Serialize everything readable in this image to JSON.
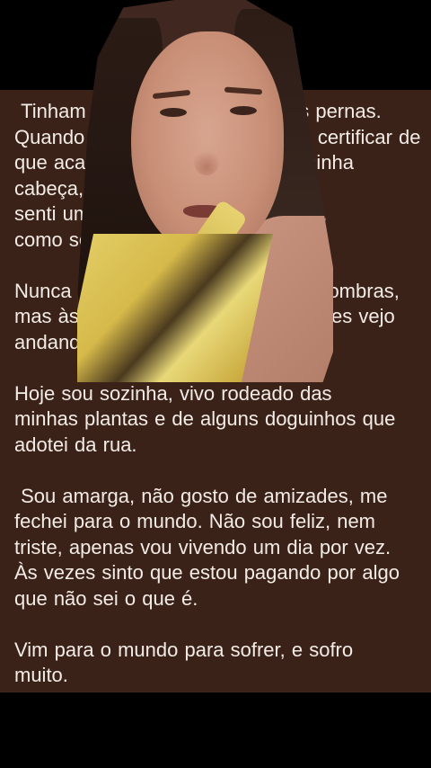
{
  "story": {
    "text": " Tinham brincado com as minhas pernas.\nQuando terminaram, quiseram se certificar de\nque acabou, colocaram algo na minha cabeça,\nsenti um peso sobre a minha nuca,\ncomo se quisessem me sufocar.\n\nNunca fui de dar atenção para as sombras,\nmas às vezes ainda as vejo, às vezes vejo\nandando por aí.\n\nHoje sou sozinha, vivo rodeado das\nminhas plantas e de alguns doguinhos que\nadotei da rua.\n\n Sou amarga, não gosto de amizades, me\nfechei para o mundo. Não sou feliz, nem\ntriste, apenas vou vivendo um dia por vez.\nÀs vezes sinto que estou pagando por algo\nque não sei o que é.\n\nVim para o mundo para sofrer, e sofro\nmuito.\nHoje, apenas aguardo o meu momento de\npartir e reencontrar a paz."
  },
  "colors": {
    "panel_background": "#3b2219",
    "text": "#f3ece6",
    "letterbox": "#000000"
  },
  "overlay": {
    "kind": "selfie-video-cutout"
  }
}
